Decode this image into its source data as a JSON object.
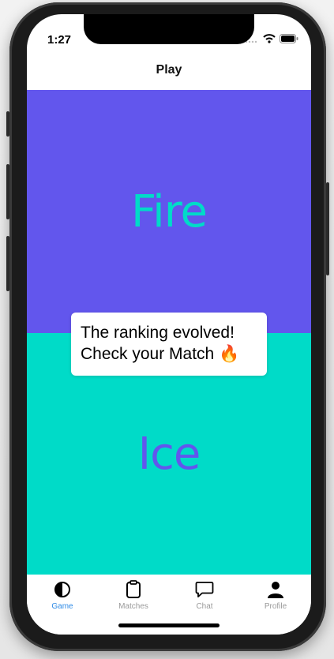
{
  "status_bar": {
    "time": "1:27",
    "icons": [
      "signal-icon",
      "wifi-icon",
      "battery-icon"
    ]
  },
  "nav": {
    "title": "Play"
  },
  "options": {
    "top": {
      "label": "Fire",
      "background": "#6256ED",
      "text_color": "#00DBC8"
    },
    "bottom": {
      "label": "Ice",
      "background": "#00DBC8",
      "text_color": "#6256ED"
    }
  },
  "toast": {
    "line1": "The ranking evolved!",
    "line2": "Check your Match 🔥"
  },
  "tab_bar": {
    "active_color": "#2F8BE6",
    "items": [
      {
        "label": "Game",
        "icon": "half-circle-icon",
        "active": true
      },
      {
        "label": "Matches",
        "icon": "clipboard-icon",
        "active": false
      },
      {
        "label": "Chat",
        "icon": "chat-bubble-icon",
        "active": false
      },
      {
        "label": "Profile",
        "icon": "person-icon",
        "active": false
      }
    ]
  }
}
